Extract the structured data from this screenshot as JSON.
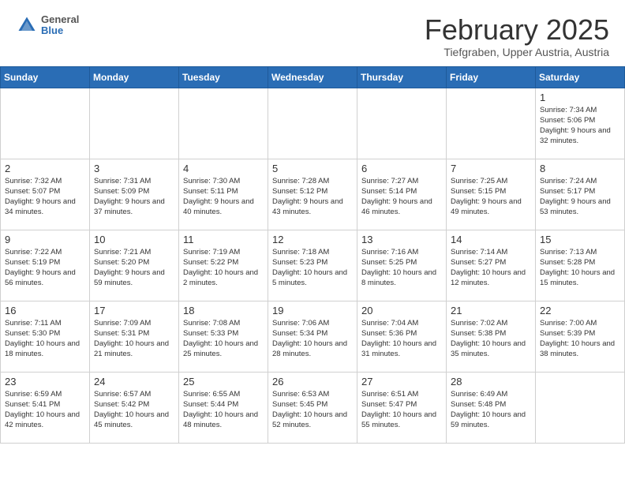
{
  "header": {
    "logo_general": "General",
    "logo_blue": "Blue",
    "month_title": "February 2025",
    "location": "Tiefgraben, Upper Austria, Austria"
  },
  "calendar": {
    "days_of_week": [
      "Sunday",
      "Monday",
      "Tuesday",
      "Wednesday",
      "Thursday",
      "Friday",
      "Saturday"
    ],
    "weeks": [
      [
        {
          "day": "",
          "info": "",
          "empty": true
        },
        {
          "day": "",
          "info": "",
          "empty": true
        },
        {
          "day": "",
          "info": "",
          "empty": true
        },
        {
          "day": "",
          "info": "",
          "empty": true
        },
        {
          "day": "",
          "info": "",
          "empty": true
        },
        {
          "day": "",
          "info": "",
          "empty": true
        },
        {
          "day": "1",
          "info": "Sunrise: 7:34 AM\nSunset: 5:06 PM\nDaylight: 9 hours and 32 minutes.",
          "empty": false
        }
      ],
      [
        {
          "day": "2",
          "info": "Sunrise: 7:32 AM\nSunset: 5:07 PM\nDaylight: 9 hours and 34 minutes.",
          "empty": false
        },
        {
          "day": "3",
          "info": "Sunrise: 7:31 AM\nSunset: 5:09 PM\nDaylight: 9 hours and 37 minutes.",
          "empty": false
        },
        {
          "day": "4",
          "info": "Sunrise: 7:30 AM\nSunset: 5:11 PM\nDaylight: 9 hours and 40 minutes.",
          "empty": false
        },
        {
          "day": "5",
          "info": "Sunrise: 7:28 AM\nSunset: 5:12 PM\nDaylight: 9 hours and 43 minutes.",
          "empty": false
        },
        {
          "day": "6",
          "info": "Sunrise: 7:27 AM\nSunset: 5:14 PM\nDaylight: 9 hours and 46 minutes.",
          "empty": false
        },
        {
          "day": "7",
          "info": "Sunrise: 7:25 AM\nSunset: 5:15 PM\nDaylight: 9 hours and 49 minutes.",
          "empty": false
        },
        {
          "day": "8",
          "info": "Sunrise: 7:24 AM\nSunset: 5:17 PM\nDaylight: 9 hours and 53 minutes.",
          "empty": false
        }
      ],
      [
        {
          "day": "9",
          "info": "Sunrise: 7:22 AM\nSunset: 5:19 PM\nDaylight: 9 hours and 56 minutes.",
          "empty": false
        },
        {
          "day": "10",
          "info": "Sunrise: 7:21 AM\nSunset: 5:20 PM\nDaylight: 9 hours and 59 minutes.",
          "empty": false
        },
        {
          "day": "11",
          "info": "Sunrise: 7:19 AM\nSunset: 5:22 PM\nDaylight: 10 hours and 2 minutes.",
          "empty": false
        },
        {
          "day": "12",
          "info": "Sunrise: 7:18 AM\nSunset: 5:23 PM\nDaylight: 10 hours and 5 minutes.",
          "empty": false
        },
        {
          "day": "13",
          "info": "Sunrise: 7:16 AM\nSunset: 5:25 PM\nDaylight: 10 hours and 8 minutes.",
          "empty": false
        },
        {
          "day": "14",
          "info": "Sunrise: 7:14 AM\nSunset: 5:27 PM\nDaylight: 10 hours and 12 minutes.",
          "empty": false
        },
        {
          "day": "15",
          "info": "Sunrise: 7:13 AM\nSunset: 5:28 PM\nDaylight: 10 hours and 15 minutes.",
          "empty": false
        }
      ],
      [
        {
          "day": "16",
          "info": "Sunrise: 7:11 AM\nSunset: 5:30 PM\nDaylight: 10 hours and 18 minutes.",
          "empty": false
        },
        {
          "day": "17",
          "info": "Sunrise: 7:09 AM\nSunset: 5:31 PM\nDaylight: 10 hours and 21 minutes.",
          "empty": false
        },
        {
          "day": "18",
          "info": "Sunrise: 7:08 AM\nSunset: 5:33 PM\nDaylight: 10 hours and 25 minutes.",
          "empty": false
        },
        {
          "day": "19",
          "info": "Sunrise: 7:06 AM\nSunset: 5:34 PM\nDaylight: 10 hours and 28 minutes.",
          "empty": false
        },
        {
          "day": "20",
          "info": "Sunrise: 7:04 AM\nSunset: 5:36 PM\nDaylight: 10 hours and 31 minutes.",
          "empty": false
        },
        {
          "day": "21",
          "info": "Sunrise: 7:02 AM\nSunset: 5:38 PM\nDaylight: 10 hours and 35 minutes.",
          "empty": false
        },
        {
          "day": "22",
          "info": "Sunrise: 7:00 AM\nSunset: 5:39 PM\nDaylight: 10 hours and 38 minutes.",
          "empty": false
        }
      ],
      [
        {
          "day": "23",
          "info": "Sunrise: 6:59 AM\nSunset: 5:41 PM\nDaylight: 10 hours and 42 minutes.",
          "empty": false
        },
        {
          "day": "24",
          "info": "Sunrise: 6:57 AM\nSunset: 5:42 PM\nDaylight: 10 hours and 45 minutes.",
          "empty": false
        },
        {
          "day": "25",
          "info": "Sunrise: 6:55 AM\nSunset: 5:44 PM\nDaylight: 10 hours and 48 minutes.",
          "empty": false
        },
        {
          "day": "26",
          "info": "Sunrise: 6:53 AM\nSunset: 5:45 PM\nDaylight: 10 hours and 52 minutes.",
          "empty": false
        },
        {
          "day": "27",
          "info": "Sunrise: 6:51 AM\nSunset: 5:47 PM\nDaylight: 10 hours and 55 minutes.",
          "empty": false
        },
        {
          "day": "28",
          "info": "Sunrise: 6:49 AM\nSunset: 5:48 PM\nDaylight: 10 hours and 59 minutes.",
          "empty": false
        },
        {
          "day": "",
          "info": "",
          "empty": true
        }
      ]
    ]
  }
}
